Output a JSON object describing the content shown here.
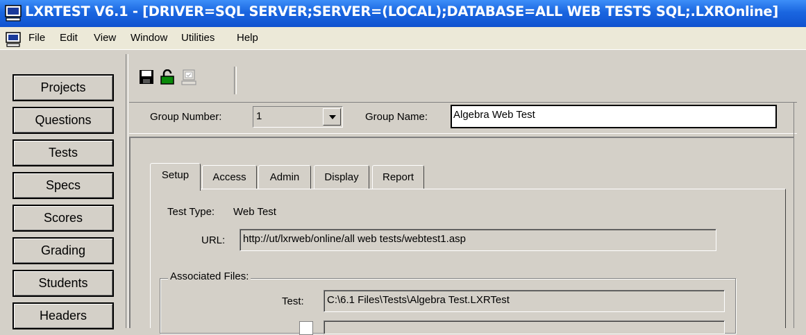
{
  "window": {
    "title": "LXRTEST V6.1 - [DRIVER=SQL SERVER;SERVER=(LOCAL);DATABASE=ALL WEB TESTS SQL;.LXROnline]"
  },
  "menubar": {
    "items": [
      {
        "label": "File"
      },
      {
        "label": "Edit"
      },
      {
        "label": "View"
      },
      {
        "label": "Window"
      },
      {
        "label": "Utilities"
      },
      {
        "label": "Help"
      }
    ]
  },
  "sidebar": {
    "items": [
      {
        "label": "Projects"
      },
      {
        "label": "Questions"
      },
      {
        "label": "Tests"
      },
      {
        "label": "Specs"
      },
      {
        "label": "Scores"
      },
      {
        "label": "Grading"
      },
      {
        "label": "Students"
      },
      {
        "label": "Headers"
      }
    ]
  },
  "toolbar": {
    "icons": [
      "save-icon",
      "unlock-icon",
      "computer-icon"
    ]
  },
  "group": {
    "number_label": "Group Number:",
    "number_value": "1",
    "name_label": "Group Name:",
    "name_value": "Algebra Web Test"
  },
  "tabs": [
    {
      "label": "Setup",
      "active": true
    },
    {
      "label": "Access"
    },
    {
      "label": "Admin"
    },
    {
      "label": "Display"
    },
    {
      "label": "Report"
    }
  ],
  "setup": {
    "test_type_label": "Test Type:",
    "test_type_value": "Web Test",
    "url_label": "URL:",
    "url_value": "http://ut/lxrweb/online/all web tests/webtest1.asp",
    "associated_files_label": "Associated Files:",
    "test_label": "Test:",
    "test_value": "C:\\6.1 Files\\Tests\\Algebra Test.LXRTest"
  },
  "colors": {
    "titlebar": "#1a66e0",
    "window_bg": "#d4d0c8",
    "menubar_bg": "#ece9d8"
  }
}
